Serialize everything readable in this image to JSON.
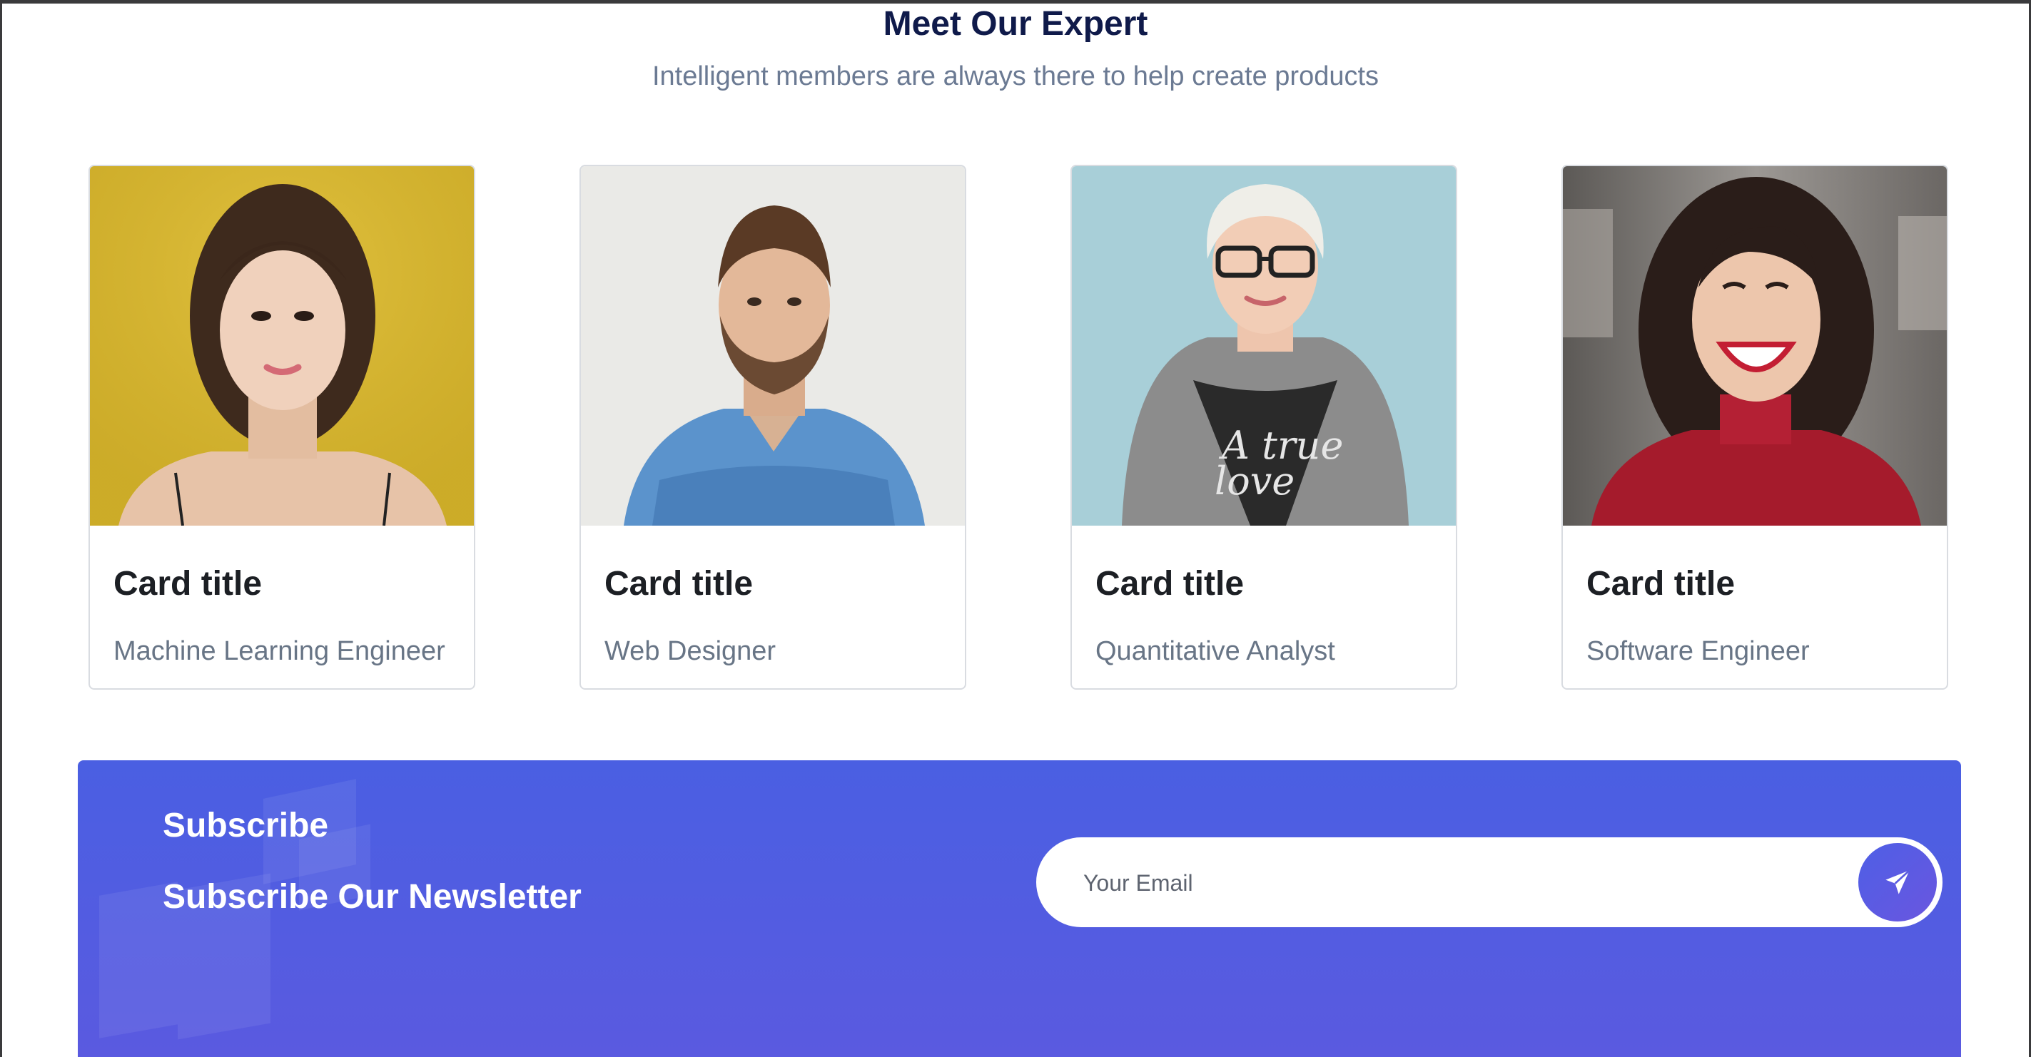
{
  "section": {
    "title": "Meet Our Expert",
    "subtitle": "Intelligent members are always there to help create products"
  },
  "cards": [
    {
      "title": "Card title",
      "text": "Machine Learning Engineer",
      "photo_bg": "#d6b62f"
    },
    {
      "title": "Card title",
      "text": "Web Designer",
      "photo_bg": "#e9e9e6"
    },
    {
      "title": "Card title",
      "text": "Quantitative Analyst",
      "photo_bg": "#a8cdd6"
    },
    {
      "title": "Card title",
      "text": "Software Engineer",
      "photo_bg": "#7d7a78"
    }
  ],
  "subscribe": {
    "title": "Subscribe",
    "heading": "Subscribe Our Newsletter",
    "email_placeholder": "Your Email",
    "send_icon": "paper-plane-icon",
    "accent_color": "#4f5de3"
  }
}
